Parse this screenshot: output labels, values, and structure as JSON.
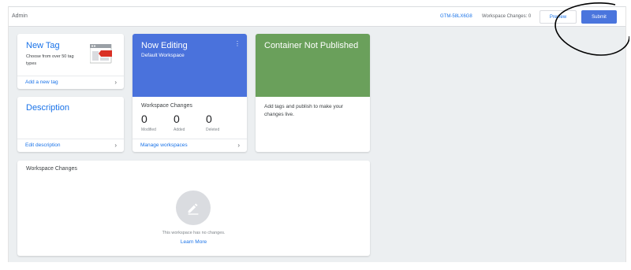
{
  "header": {
    "section": "Admin",
    "container_id": "GTM-58LX6G8",
    "workspace_changes": "Workspace Changes: 0",
    "preview_label": "Preview",
    "submit_label": "Submit",
    "accent": "#1a73e8",
    "submit_color": "#4a75dd"
  },
  "new_tag": {
    "title": "New Tag",
    "subtitle": "Choose from over 50 tag types",
    "link": "Add a new tag",
    "icon": "tag-illustration-icon"
  },
  "description": {
    "title": "Description",
    "link": "Edit description"
  },
  "now_editing": {
    "title": "Now Editing",
    "workspace": "Default Workspace",
    "changes_label": "Workspace Changes",
    "counts": [
      {
        "value": "0",
        "label": "Modified"
      },
      {
        "value": "0",
        "label": "Added"
      },
      {
        "value": "0",
        "label": "Deleted"
      }
    ],
    "link": "Manage workspaces",
    "color": "#4a72dc"
  },
  "not_published": {
    "title": "Container Not Published",
    "body": "Add tags and publish to make your changes live.",
    "color": "#6aa05b"
  },
  "workspace_changes_card": {
    "title": "Workspace Changes",
    "empty_text": "This workspace has no changes.",
    "link": "Learn More",
    "icon": "pencil-icon"
  }
}
